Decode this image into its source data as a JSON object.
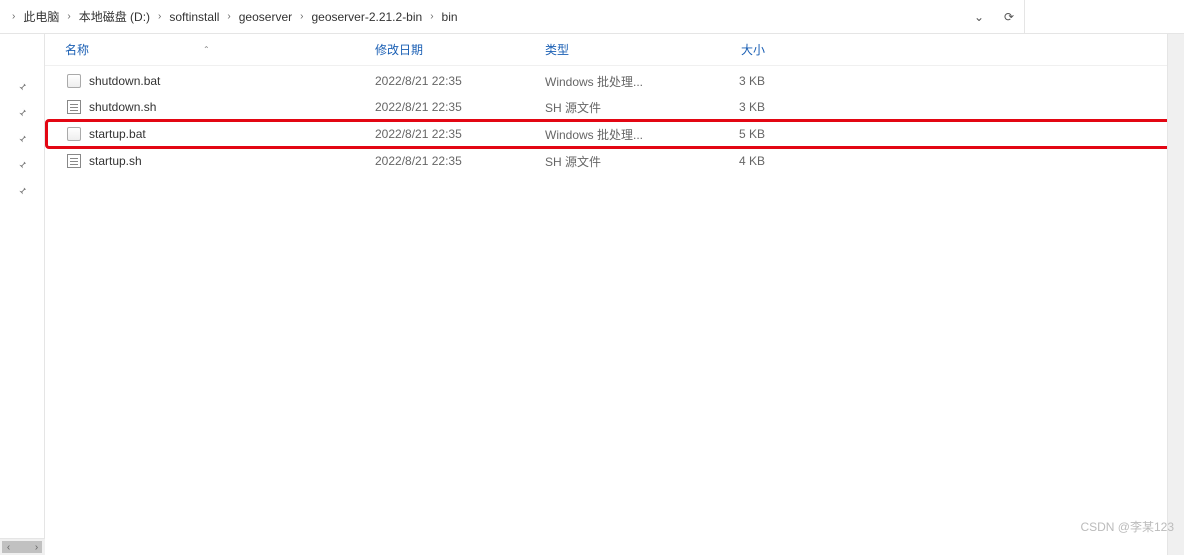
{
  "breadcrumb": {
    "items": [
      "此电脑",
      "本地磁盘 (D:)",
      "softinstall",
      "geoserver",
      "geoserver-2.21.2-bin",
      "bin"
    ]
  },
  "columns": {
    "name": "名称",
    "date": "修改日期",
    "type": "类型",
    "size": "大小"
  },
  "files": [
    {
      "icon": "bat",
      "name": "shutdown.bat",
      "date": "2022/8/21 22:35",
      "type": "Windows 批处理...",
      "size": "3 KB",
      "highlighted": false
    },
    {
      "icon": "sh",
      "name": "shutdown.sh",
      "date": "2022/8/21 22:35",
      "type": "SH 源文件",
      "size": "3 KB",
      "highlighted": false
    },
    {
      "icon": "bat",
      "name": "startup.bat",
      "date": "2022/8/21 22:35",
      "type": "Windows 批处理...",
      "size": "5 KB",
      "highlighted": true
    },
    {
      "icon": "sh",
      "name": "startup.sh",
      "date": "2022/8/21 22:35",
      "type": "SH 源文件",
      "size": "4 KB",
      "highlighted": false
    }
  ],
  "watermark": "CSDN @李某123",
  "icons": {
    "chevron_right": "›",
    "chevron_down": "⌄",
    "refresh": "⟳"
  }
}
